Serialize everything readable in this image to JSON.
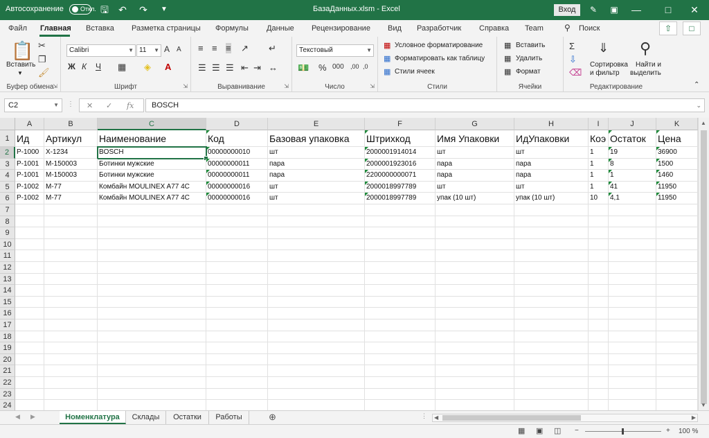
{
  "titlebar": {
    "autosave": "Автосохранение",
    "toggle_state": "Откл.",
    "title": "БазаДанных.xlsm  -  Excel",
    "signin": "Вход"
  },
  "menu": [
    "Файл",
    "Главная",
    "Вставка",
    "Разметка страницы",
    "Формулы",
    "Данные",
    "Рецензирование",
    "Вид",
    "Разработчик",
    "Справка",
    "Team",
    "Поиск"
  ],
  "ribbon": {
    "clipboard": {
      "paste": "Вставить",
      "label": "Буфер обмена"
    },
    "font": {
      "name": "Calibri",
      "size": "11",
      "bold": "Ж",
      "italic": "К",
      "underline": "Ч",
      "grow": "A",
      "shrink": "A",
      "label": "Шрифт"
    },
    "alignment": {
      "label": "Выравнивание"
    },
    "number": {
      "format": "Текстовый",
      "label": "Число"
    },
    "styles": {
      "conditional": "Условное форматирование",
      "as_table": "Форматировать как таблицу",
      "cell_styles": "Стили ячеек",
      "label": "Стили"
    },
    "cells": {
      "insert": "Вставить",
      "delete": "Удалить",
      "format": "Формат",
      "label": "Ячейки"
    },
    "editing": {
      "sort": "Сортировка",
      "sort2": "и фильтр",
      "find": "Найти и",
      "find2": "выделить",
      "label": "Редактирование"
    }
  },
  "formula_bar": {
    "name_box": "C2",
    "fx": "fx",
    "value": "BOSCH"
  },
  "columns": [
    "A",
    "B",
    "C",
    "D",
    "E",
    "F",
    "G",
    "H",
    "I",
    "J",
    "K"
  ],
  "rows": [
    [
      "Ид",
      "Артикул",
      "Наименование",
      "Код",
      "Базовая упаковка",
      "Штрихкод",
      "Имя Упаковки",
      "ИдУпаковки",
      "Коэ",
      "Остаток",
      "Цена"
    ],
    [
      "P-1000",
      "X-1234",
      "BOSCH",
      "00000000010",
      "шт",
      "2000001914014",
      "шт",
      "шт",
      "1",
      "19",
      "36900"
    ],
    [
      "P-1001",
      "M-150003",
      "Ботинки мужские",
      "00000000011",
      "пара",
      "2000001923016",
      "пара",
      "пара",
      "1",
      "8",
      "1500"
    ],
    [
      "P-1001",
      "M-150003",
      "Ботинки мужские",
      "00000000011",
      "пара",
      "2200000000071",
      "пара",
      "пара",
      "1",
      "1",
      "1460"
    ],
    [
      "P-1002",
      "M-77",
      "Комбайн MOULINEX  A77 4C",
      "00000000016",
      "шт",
      "2000018997789",
      "шт",
      "шт",
      "1",
      "41",
      "11950"
    ],
    [
      "P-1002",
      "M-77",
      "Комбайн MOULINEX  A77 4C",
      "00000000016",
      "шт",
      "2000018997789",
      "упак (10 шт)",
      "упак (10 шт)",
      "10",
      "4,1",
      "11950"
    ]
  ],
  "row_numbers": [
    "1",
    "2",
    "3",
    "4",
    "5",
    "6",
    "7",
    "8",
    "9",
    "10",
    "11",
    "12",
    "13",
    "14",
    "15",
    "16",
    "17",
    "18",
    "19",
    "20",
    "21",
    "22",
    "23",
    "24"
  ],
  "sheets": [
    "Номенклатура",
    "Склады",
    "Остатки",
    "Работы"
  ],
  "status": {
    "zoom": "100 %"
  }
}
